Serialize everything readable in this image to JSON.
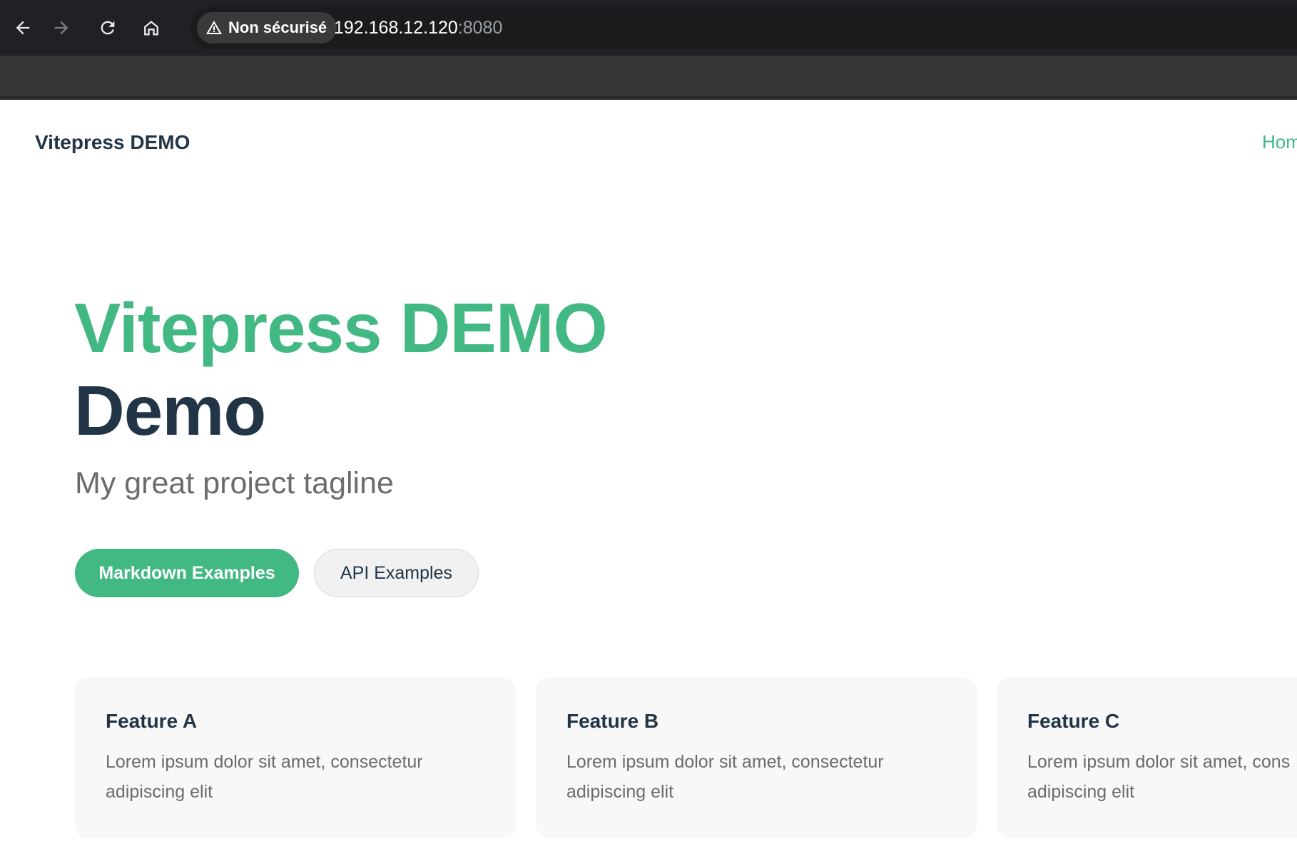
{
  "browser": {
    "security_label": "Non sécurisé",
    "url_host": "192.168.12.120",
    "url_port": ":8080",
    "icons": [
      "back-arrow-icon",
      "forward-arrow-icon",
      "reload-icon",
      "home-icon",
      "warning-icon"
    ]
  },
  "nav": {
    "site_title": "Vitepress DEMO",
    "home_link": "Hom"
  },
  "hero": {
    "name": "Vitepress DEMO",
    "text": "Demo",
    "tagline": "My great project tagline",
    "actions": [
      {
        "label": "Markdown Examples",
        "theme": "brand"
      },
      {
        "label": "API Examples",
        "theme": "alt"
      }
    ]
  },
  "features": [
    {
      "title": "Feature A",
      "details_line1": "Lorem ipsum dolor sit amet, consectetur",
      "details_line2": "adipiscing elit"
    },
    {
      "title": "Feature B",
      "details_line1": "Lorem ipsum dolor sit amet, consectetur",
      "details_line2": "adipiscing elit"
    },
    {
      "title": "Feature C",
      "details_line1": "Lorem ipsum dolor sit amet, cons",
      "details_line2": "adipiscing elit"
    }
  ],
  "colors": {
    "brand": "#42b883",
    "heading": "#213547",
    "muted_text": "#6b6b6b",
    "card_bg": "#f8f8f8",
    "chrome_bg": "#202124"
  }
}
